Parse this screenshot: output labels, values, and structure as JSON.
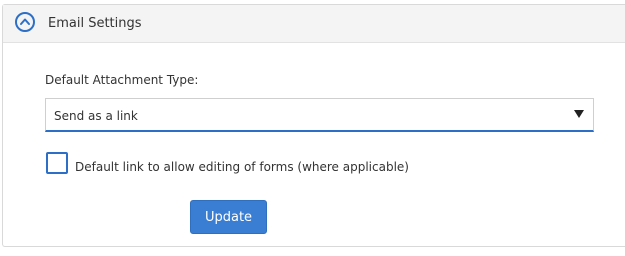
{
  "panel": {
    "title": "Email Settings",
    "collapse_icon": "chevron-up-circle-icon"
  },
  "attachment": {
    "label": "Default Attachment Type:",
    "selected": "Send as a link",
    "dropdown_icon": "triangle-down-icon"
  },
  "edit_option": {
    "label": "Default link to allow editing of forms (where applicable)",
    "checked": false
  },
  "actions": {
    "update_label": "Update"
  },
  "colors": {
    "accent": "#2d6fc7",
    "button": "#3a7ed3",
    "header_bg": "#f4f4f4",
    "text": "#333333"
  }
}
